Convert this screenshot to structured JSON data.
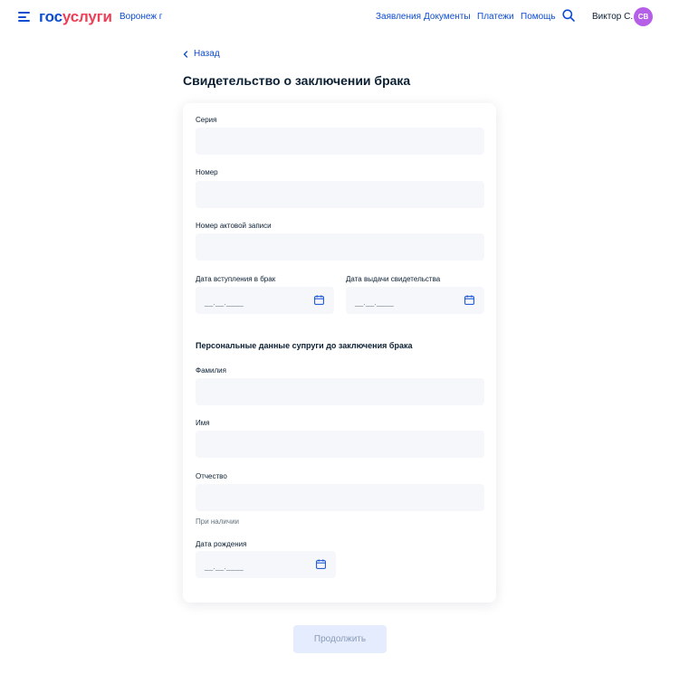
{
  "header": {
    "logo_part1": "гос",
    "logo_part2": "услуги",
    "region": "Воронеж г",
    "nav": [
      "Заявления",
      "Документы",
      "Платежи",
      "Помощь"
    ],
    "user_name": "Виктор С.",
    "avatar_initials": "СВ"
  },
  "page": {
    "back_label": "Назад",
    "title": "Свидетельство о заключении брака"
  },
  "form": {
    "series_label": "Серия",
    "number_label": "Номер",
    "act_record_label": "Номер актовой записи",
    "marriage_date_label": "Дата вступления в брак",
    "issue_date_label": "Дата выдачи свидетельства",
    "date_placeholder": "__.__.____",
    "section_title": "Персональные данные супруги до заключения брака",
    "surname_label": "Фамилия",
    "name_label": "Имя",
    "patronymic_label": "Отчество",
    "patronymic_hint": "При наличии",
    "birth_date_label": "Дата рождения"
  },
  "actions": {
    "continue_label": "Продолжить"
  },
  "colors": {
    "brand_blue": "#0d4cd3",
    "brand_red": "#ee3f58",
    "avatar": "#b55ee8",
    "field_bg": "#f5f7fa"
  }
}
